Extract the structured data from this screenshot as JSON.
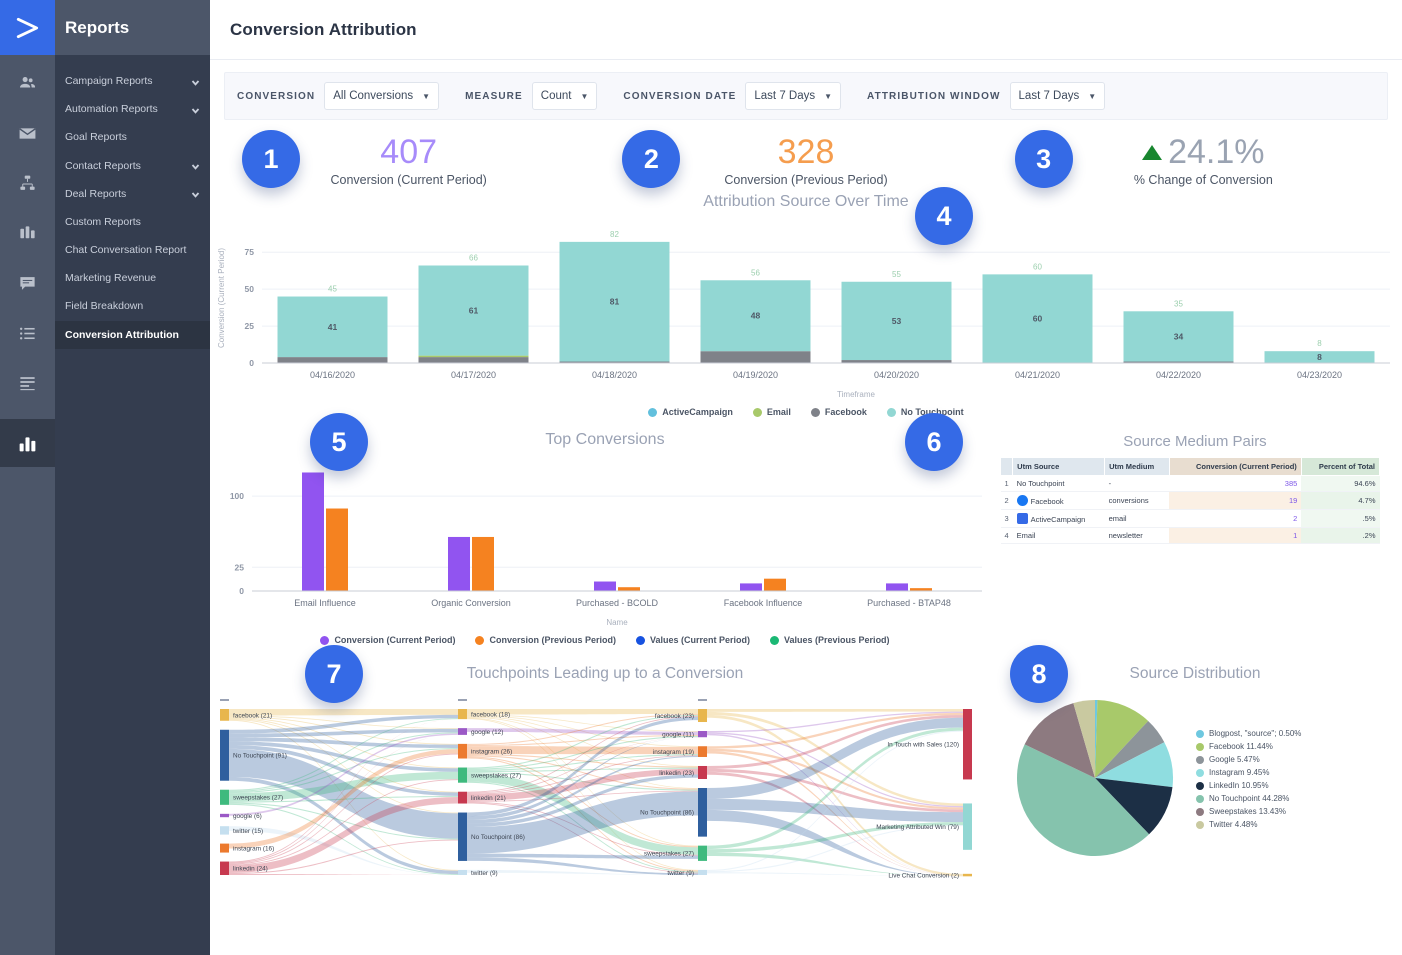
{
  "sidebar": {
    "brand": "Reports",
    "logo_icon": "activecampaign-logo-icon",
    "rail_icons": [
      "contacts-icon",
      "email-icon",
      "automation-icon",
      "deals-icon",
      "conversations-icon",
      "lists-icon",
      "forms-icon",
      "reports-icon"
    ],
    "items": [
      {
        "label": "Campaign Reports",
        "expandable": true
      },
      {
        "label": "Automation Reports",
        "expandable": true
      },
      {
        "label": "Goal Reports",
        "expandable": false
      },
      {
        "label": "Contact Reports",
        "expandable": true
      },
      {
        "label": "Deal Reports",
        "expandable": true
      },
      {
        "label": "Custom Reports",
        "expandable": false
      },
      {
        "label": "Chat Conversation Report",
        "expandable": false
      },
      {
        "label": "Marketing Revenue",
        "expandable": false
      },
      {
        "label": "Field Breakdown",
        "expandable": false
      },
      {
        "label": "Conversion Attribution",
        "expandable": false,
        "active": true
      }
    ]
  },
  "header": {
    "title": "Conversion Attribution"
  },
  "filters": [
    {
      "label": "CONVERSION",
      "value": "All Conversions"
    },
    {
      "label": "MEASURE",
      "value": "Count"
    },
    {
      "label": "CONVERSION DATE",
      "value": "Last 7 Days"
    },
    {
      "label": "ATTRIBUTION WINDOW",
      "value": "Last 7 Days"
    }
  ],
  "kpis": [
    {
      "badge": "1",
      "value": "407",
      "caption": "Conversion (Current Period)",
      "color": "#a78bfa"
    },
    {
      "badge": "2",
      "value": "328",
      "caption": "Conversion (Previous Period)",
      "color": "#f59d4e"
    },
    {
      "badge": "3",
      "value": "24.1%",
      "caption": "% Change of Conversion",
      "color": "#9aa3b2",
      "trend": "up",
      "trend_color": "#18862f"
    }
  ],
  "badges": {
    "b4": "4",
    "b5": "5",
    "b6": "6",
    "b7": "7",
    "b8": "8"
  },
  "chart_data": [
    {
      "type": "bar",
      "title": "Attribution Source Over Time",
      "xlabel": "Timeframe",
      "ylabel": "Conversion (Current Period)",
      "ylim": [
        0,
        88
      ],
      "yticks": [
        0,
        25,
        50,
        75
      ],
      "grid": true,
      "stacked": true,
      "categories": [
        "04/16/2020",
        "04/17/2020",
        "04/18/2020",
        "04/19/2020",
        "04/20/2020",
        "04/21/2020",
        "04/22/2020",
        "04/23/2020"
      ],
      "totals": [
        45,
        66,
        82,
        56,
        55,
        60,
        35,
        8
      ],
      "series": [
        {
          "name": "No Touchpoint",
          "color": "#92d7d3",
          "values": [
            41,
            61,
            81,
            48,
            53,
            60,
            34,
            8
          ]
        },
        {
          "name": "Facebook",
          "color": "#7f8289",
          "values": [
            4,
            4,
            1,
            8,
            2,
            0,
            1,
            0
          ]
        },
        {
          "name": "Email",
          "color": "#a8c96a",
          "values": [
            0,
            1,
            0,
            0,
            0,
            0,
            0,
            0
          ]
        },
        {
          "name": "ActiveCampaign",
          "color": "#62c0dd",
          "values": [
            0,
            0,
            0,
            0,
            0,
            0,
            0,
            0
          ]
        }
      ],
      "legend": [
        {
          "name": "ActiveCampaign",
          "color": "#62c0dd"
        },
        {
          "name": "Email",
          "color": "#a8c96a"
        },
        {
          "name": "Facebook",
          "color": "#7f8289"
        },
        {
          "name": "No Touchpoint",
          "color": "#92d7d3"
        }
      ],
      "legend_position": "bottom"
    },
    {
      "type": "bar",
      "title": "Top Conversions",
      "xlabel": "Name",
      "ylabel": "",
      "ylim": [
        0,
        135
      ],
      "yticks": [
        0,
        25,
        100
      ],
      "grid": true,
      "categories": [
        "Email Influence",
        "Organic Conversion",
        "Purchased - BCOLD",
        "Facebook Influence",
        "Purchased - BTAP48"
      ],
      "series": [
        {
          "name": "Conversion (Current Period)",
          "color": "#9154f0",
          "values": [
            125,
            57,
            10,
            8,
            8
          ]
        },
        {
          "name": "Conversion (Previous Period)",
          "color": "#f58220",
          "values": [
            87,
            57,
            4,
            13,
            3
          ]
        },
        {
          "name": "Values (Current Period)",
          "color": "#1752e0",
          "values": [
            0,
            0,
            0,
            0,
            0
          ]
        },
        {
          "name": "Values (Previous Period)",
          "color": "#1bb874",
          "values": [
            0,
            0,
            0,
            0,
            0
          ]
        }
      ],
      "legend": [
        {
          "name": "Conversion (Current Period)",
          "color": "#9154f0"
        },
        {
          "name": "Conversion (Previous Period)",
          "color": "#f58220"
        },
        {
          "name": "Values (Current Period)",
          "color": "#1752e0"
        },
        {
          "name": "Values (Previous Period)",
          "color": "#1bb874"
        }
      ],
      "legend_position": "bottom"
    },
    {
      "type": "pie",
      "title": "Source Distribution",
      "legend_position": "right",
      "categories": [
        "Blogpost, \"source\";",
        "Facebook",
        "Google",
        "Instagram",
        "LinkedIn",
        "No Touchpoint",
        "Sweepstakes",
        "Twitter"
      ],
      "labels": [
        "Blogpost, \"source\"; 0.50%",
        "Facebook 11.44%",
        "Google 5.47%",
        "Instagram 9.45%",
        "LinkedIn 10.95%",
        "No Touchpoint 44.28%",
        "Sweepstakes 13.43%",
        "Twitter 4.48%"
      ],
      "values": [
        0.5,
        11.44,
        5.47,
        9.45,
        10.95,
        44.28,
        13.43,
        4.48
      ],
      "colors": [
        "#6ec8e0",
        "#a8c96a",
        "#8d949a",
        "#8fdde0",
        "#1c2f45",
        "#85c3ad",
        "#8d7a80",
        "#c9c9a0"
      ]
    }
  ],
  "source_medium_pairs": {
    "title": "Source Medium Pairs",
    "columns": [
      "Utm Source",
      "Utm Medium",
      "Conversion (Current Period)",
      "Percent of Total"
    ],
    "rows": [
      {
        "n": "1",
        "source": "No Touchpoint",
        "medium": "-",
        "conversion": "385",
        "percent": "94.6%",
        "icon": null
      },
      {
        "n": "2",
        "source": "Facebook",
        "medium": "conversions",
        "conversion": "19",
        "percent": "4.7%",
        "icon": "facebook-icon"
      },
      {
        "n": "3",
        "source": "ActiveCampaign",
        "medium": "email",
        "conversion": "2",
        "percent": ".5%",
        "icon": "activecampaign-icon"
      },
      {
        "n": "4",
        "source": "Email",
        "medium": "newsletter",
        "conversion": "1",
        "percent": ".2%",
        "icon": null
      }
    ]
  },
  "sankey": {
    "title": "Touchpoints Leading up to a Conversion",
    "columns": [
      [
        {
          "label": "facebook (21)",
          "value": 21,
          "color": "#e8b64d"
        },
        {
          "label": "No Touchpoint (91)",
          "value": 91,
          "color": "#2f5f9e"
        },
        {
          "label": "sweepstakes (27)",
          "value": 27,
          "color": "#3fba7e"
        },
        {
          "label": "google (6)",
          "value": 6,
          "color": "#9b59c6"
        },
        {
          "label": "twitter (15)",
          "value": 15,
          "color": "#c5dfef"
        },
        {
          "label": "instagram (16)",
          "value": 16,
          "color": "#ec7a2e"
        },
        {
          "label": "linkedin (24)",
          "value": 24,
          "color": "#c7394f"
        }
      ],
      [
        {
          "label": "facebook (18)",
          "value": 18,
          "color": "#e8b64d"
        },
        {
          "label": "google (12)",
          "value": 12,
          "color": "#9b59c6"
        },
        {
          "label": "instagram (26)",
          "value": 26,
          "color": "#ec7a2e"
        },
        {
          "label": "sweepstakes (27)",
          "value": 27,
          "color": "#3fba7e"
        },
        {
          "label": "linkedin (21)",
          "value": 21,
          "color": "#c7394f"
        },
        {
          "label": "No Touchpoint (86)",
          "value": 86,
          "color": "#2f5f9e"
        },
        {
          "label": "twitter (9)",
          "value": 9,
          "color": "#c5dfef"
        }
      ],
      [
        {
          "label": "facebook (23)",
          "value": 23,
          "color": "#e8b64d"
        },
        {
          "label": "google (11)",
          "value": 11,
          "color": "#9b59c6"
        },
        {
          "label": "instagram (19)",
          "value": 19,
          "color": "#ec7a2e"
        },
        {
          "label": "linkedin (23)",
          "value": 23,
          "color": "#c7394f"
        },
        {
          "label": "No Touchpoint (86)",
          "value": 86,
          "color": "#2f5f9e"
        },
        {
          "label": "sweepstakes (27)",
          "value": 27,
          "color": "#3fba7e"
        },
        {
          "label": "twitter (9)",
          "value": 9,
          "color": "#c5dfef"
        }
      ],
      [
        {
          "label": "In Touch with Sales (120)",
          "value": 120,
          "color": "#c7394f"
        },
        {
          "label": "Marketing Attributed Win (79)",
          "value": 79,
          "color": "#92d7d3"
        },
        {
          "label": "Live Chat Conversion (2)",
          "value": 2,
          "color": "#e8b64d"
        }
      ]
    ]
  }
}
